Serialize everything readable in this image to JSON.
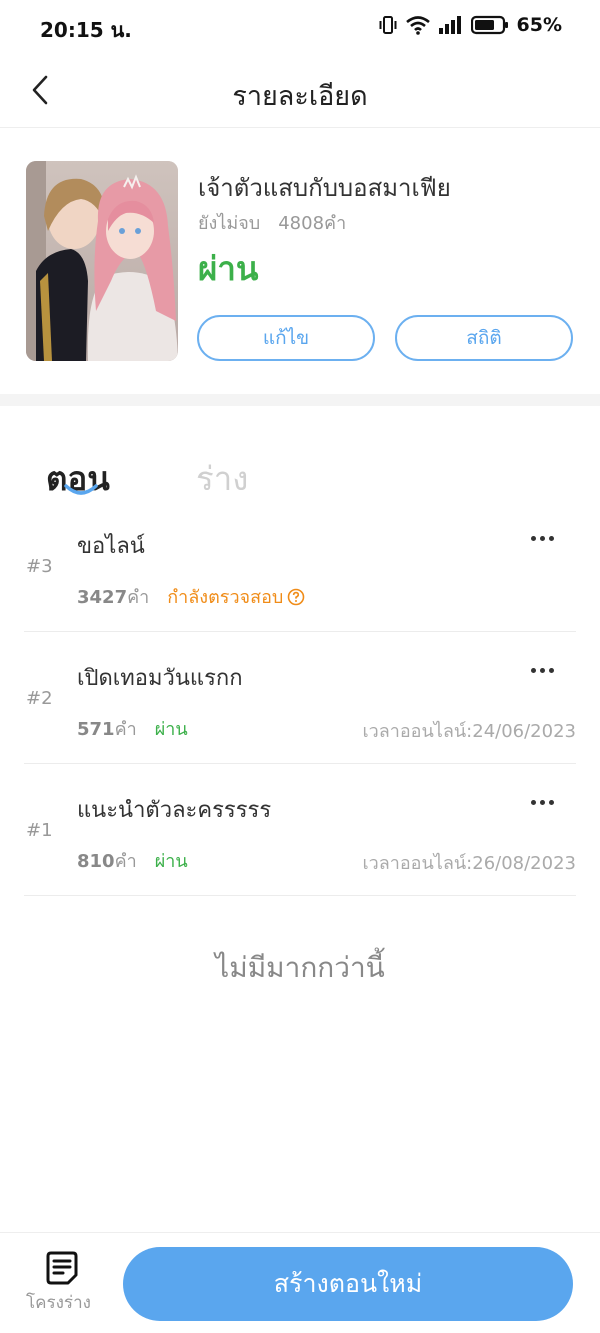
{
  "status_bar": {
    "time": "20:15 น.",
    "battery": "65%"
  },
  "header": {
    "title": "รายละเอียด"
  },
  "book": {
    "title": "เจ้าตัวแสบกับบอสมาเฟีย",
    "progress_status": "ยังไม่จบ",
    "word_count": "4808คำ",
    "review_status": "ผ่าน",
    "edit_label": "แก้ไข",
    "stats_label": "สถิติ"
  },
  "tabs": {
    "episodes": "ตอน",
    "drafts": "ร่าง"
  },
  "episodes": [
    {
      "num": "#3",
      "title": "ขอไลน์",
      "words": "3427",
      "words_unit": "คำ",
      "status": "กำลังตรวจสอบ",
      "online": ""
    },
    {
      "num": "#2",
      "title": "เปิดเทอมวันแรกก",
      "words": "571",
      "words_unit": "คำ",
      "status": "ผ่าน",
      "online": "เวลาออนไลน์:24/06/2023"
    },
    {
      "num": "#1",
      "title": "แนะนำตัวละครรรรร",
      "words": "810",
      "words_unit": "คำ",
      "status": "ผ่าน",
      "online": "เวลาออนไลน์:26/08/2023"
    }
  ],
  "no_more_text": "ไม่มีมากกว่านี้",
  "bottom_bar": {
    "draft_label": "โครงร่าง",
    "create_label": "สร้างตอนใหม่"
  },
  "colors": {
    "accent_blue": "#5aa6ee",
    "pass_green": "#3cb04a",
    "review_orange": "#f08c18"
  },
  "icons": [
    "back-icon",
    "vibrate-icon",
    "wifi-icon",
    "signal-icon",
    "battery-icon",
    "more-icon",
    "help-circle-icon",
    "draft-document-icon"
  ]
}
